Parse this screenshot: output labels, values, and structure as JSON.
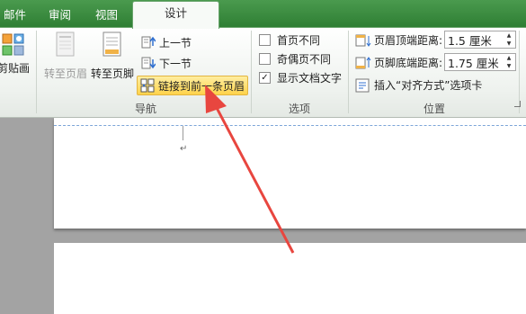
{
  "tabs": [
    {
      "label": "邮件",
      "active": false
    },
    {
      "label": "审阅",
      "active": false
    },
    {
      "label": "视图",
      "active": false
    },
    {
      "label": "设计",
      "active": true
    }
  ],
  "ribbon": {
    "clipart_label": "剪贴画",
    "navigation": {
      "group_label": "导航",
      "goto_header": "转至页眉",
      "goto_footer": "转至页脚",
      "previous_section": "上一节",
      "next_section": "下一节",
      "link_to_previous": "链接到前一条页眉"
    },
    "options": {
      "group_label": "选项",
      "items": [
        {
          "label": "首页不同",
          "checked": false
        },
        {
          "label": "奇偶页不同",
          "checked": false
        },
        {
          "label": "显示文档文字",
          "checked": true
        }
      ]
    },
    "position": {
      "group_label": "位置",
      "header_distance_label": "页眉顶端距离:",
      "header_distance_value": "1.5 厘米",
      "footer_distance_label": "页脚底端距离:",
      "footer_distance_value": "1.75 厘米",
      "insert_alignment_tab": "插入“对齐方式”选项卡"
    }
  },
  "document": {
    "paragraph_mark": "↵"
  },
  "colors": {
    "tab_bar": "#3a8a3e",
    "highlight": "#ffd34b",
    "arrow": "#e8463f",
    "page_background": "#a3a3a3"
  }
}
